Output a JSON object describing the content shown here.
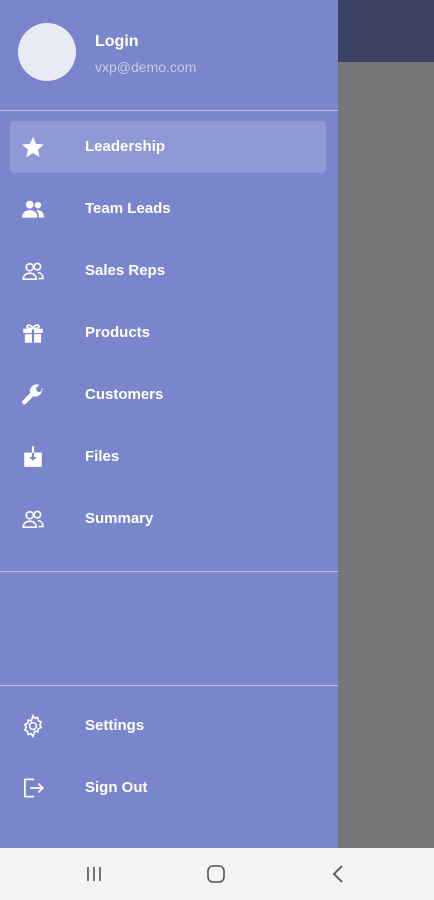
{
  "drawer": {
    "user": {
      "name": "Login",
      "email": "vxp@demo.com"
    },
    "items": [
      {
        "label": "Leadership",
        "icon": "star-icon",
        "active": true
      },
      {
        "label": "Team Leads",
        "icon": "people-filled-icon",
        "active": false
      },
      {
        "label": "Sales Reps",
        "icon": "people-outline-icon",
        "active": false
      },
      {
        "label": "Products",
        "icon": "gift-icon",
        "active": false
      },
      {
        "label": "Customers",
        "icon": "wrench-icon",
        "active": false
      },
      {
        "label": "Files",
        "icon": "download-box-icon",
        "active": false
      },
      {
        "label": "Summary",
        "icon": "people-outline-icon",
        "active": false
      }
    ],
    "footer_items": [
      {
        "label": "Settings",
        "icon": "gear-icon"
      },
      {
        "label": "Sign Out",
        "icon": "sign-out-icon"
      }
    ]
  },
  "colors": {
    "drawer_bg": "#7986cb",
    "active_bg": "#8e99d6",
    "appbar_bg": "#3d4366",
    "scrim": "#777777",
    "navbar_bg": "#f4f4f4"
  },
  "system_nav": {
    "buttons": [
      "recents-icon",
      "home-icon",
      "back-icon"
    ]
  }
}
